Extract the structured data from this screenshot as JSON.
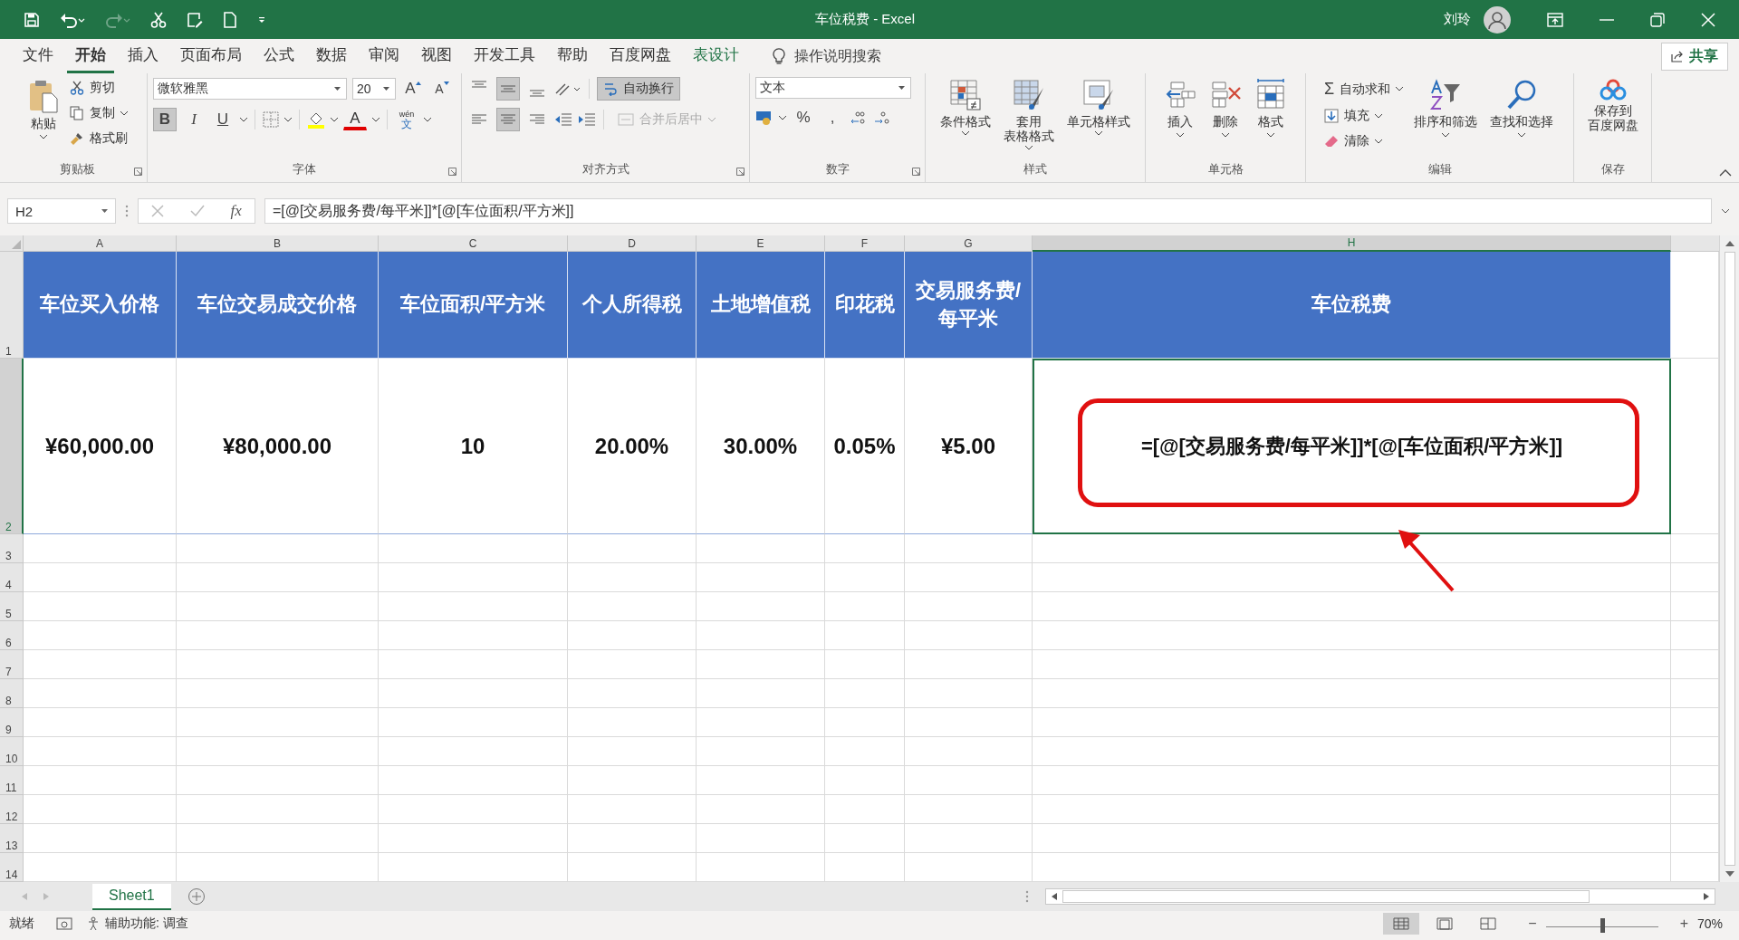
{
  "title_bar": {
    "title": "车位税费  -  Excel",
    "user": "刘玲"
  },
  "menu_tabs": [
    {
      "label": "文件",
      "selected": false,
      "kind": "normal"
    },
    {
      "label": "开始",
      "selected": true,
      "kind": "normal"
    },
    {
      "label": "插入",
      "selected": false,
      "kind": "normal"
    },
    {
      "label": "页面布局",
      "selected": false,
      "kind": "normal"
    },
    {
      "label": "公式",
      "selected": false,
      "kind": "normal"
    },
    {
      "label": "数据",
      "selected": false,
      "kind": "normal"
    },
    {
      "label": "审阅",
      "selected": false,
      "kind": "normal"
    },
    {
      "label": "视图",
      "selected": false,
      "kind": "normal"
    },
    {
      "label": "开发工具",
      "selected": false,
      "kind": "normal"
    },
    {
      "label": "帮助",
      "selected": false,
      "kind": "normal"
    },
    {
      "label": "百度网盘",
      "selected": false,
      "kind": "normal"
    },
    {
      "label": "表设计",
      "selected": false,
      "kind": "contextual"
    }
  ],
  "tell_me": "操作说明搜索",
  "share": "共享",
  "clipboard": {
    "title": "剪贴板",
    "paste": "粘贴",
    "cut": "剪切",
    "copy": "复制",
    "painter": "格式刷"
  },
  "font": {
    "title": "字体",
    "name": "微软雅黑",
    "size": "20",
    "grow": "A",
    "shrink": "A",
    "bold": {
      "label": "B",
      "selected": true
    },
    "italic": {
      "label": "I",
      "selected": false
    },
    "underline": {
      "label": "U",
      "selected": false
    },
    "color_letter": "A",
    "phonetic_reading": "wén",
    "phonetic": "文"
  },
  "alignment": {
    "title": "对齐方式",
    "vertical": [
      {
        "selected": false
      },
      {
        "selected": true
      },
      {
        "selected": false
      }
    ],
    "horizontal": [
      {
        "selected": false
      },
      {
        "selected": true
      },
      {
        "selected": false
      }
    ],
    "wrap": {
      "label": "自动换行",
      "selected": true
    },
    "merge": {
      "label": "合并后居中",
      "disabled": true
    }
  },
  "number": {
    "title": "数字",
    "format": "文本",
    "percent": "%",
    "comma": ","
  },
  "styles": {
    "title": "样式",
    "items": [
      {
        "lines": [
          "条件格式"
        ]
      },
      {
        "lines": [
          "套用",
          "表格格式"
        ]
      },
      {
        "lines": [
          "单元格样式"
        ]
      }
    ]
  },
  "cells": {
    "title": "单元格",
    "items": [
      "插入",
      "删除",
      "格式"
    ]
  },
  "editing": {
    "title": "编辑",
    "sigma": "Σ",
    "autosum": "自动求和",
    "fill": "填充",
    "clear": "清除",
    "sort": "排序和筛选",
    "find": "查找和选择"
  },
  "save": {
    "title": "保存",
    "lines": [
      "保存到",
      "百度网盘"
    ]
  },
  "formula_bar": {
    "name_box": "H2",
    "fx": "fx",
    "formula": "=[@[交易服务费/每平米]]*[@[车位面积/平方米]]"
  },
  "sheet": {
    "columns": [
      {
        "label": "A",
        "selected": false
      },
      {
        "label": "B",
        "selected": false
      },
      {
        "label": "C",
        "selected": false
      },
      {
        "label": "D",
        "selected": false
      },
      {
        "label": "E",
        "selected": false
      },
      {
        "label": "F",
        "selected": false
      },
      {
        "label": "G",
        "selected": false
      },
      {
        "label": "H",
        "selected": true
      }
    ],
    "rows": [
      {
        "number": "1",
        "selected": false
      },
      {
        "number": "2",
        "selected": true
      },
      {
        "number": "3",
        "selected": false
      },
      {
        "number": "4",
        "selected": false
      },
      {
        "number": "5",
        "selected": false
      },
      {
        "number": "6",
        "selected": false
      },
      {
        "number": "7",
        "selected": false
      },
      {
        "number": "8",
        "selected": false
      },
      {
        "number": "9",
        "selected": false
      },
      {
        "number": "10",
        "selected": false
      },
      {
        "number": "11",
        "selected": false
      },
      {
        "number": "12",
        "selected": false
      },
      {
        "number": "13",
        "selected": false
      },
      {
        "number": "14",
        "selected": false
      }
    ],
    "header_cells": [
      "车位买入价格",
      "车位交易成交价格",
      "车位面积/平方米",
      "个人所得税",
      "土地增值税",
      "印花税",
      "交易服务费/每平米",
      "车位税费"
    ],
    "data_cells": [
      "¥60,000.00",
      "¥80,000.00",
      "10",
      "20.00%",
      "30.00%",
      "0.05%",
      "¥5.00",
      "=[@[交易服务费/每平米]]*[@[车位面积/平方米]]"
    ]
  },
  "sheet_tabs": [
    {
      "label": "Sheet1",
      "selected": true
    }
  ],
  "status_bar": {
    "ready": "就绪",
    "accessibility": "辅助功能: 调查",
    "views": [
      {
        "selected": true
      },
      {
        "selected": false
      },
      {
        "selected": false
      }
    ],
    "zoom_out": "−",
    "zoom_in": "+",
    "zoom_slider": {
      "level": 0.5
    },
    "zoom": "70%"
  }
}
